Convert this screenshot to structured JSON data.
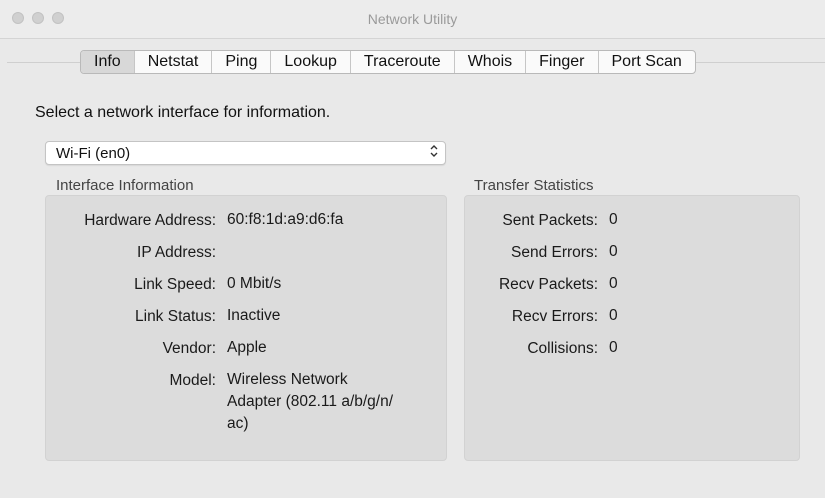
{
  "window": {
    "title": "Network Utility"
  },
  "tabs": [
    "Info",
    "Netstat",
    "Ping",
    "Lookup",
    "Traceroute",
    "Whois",
    "Finger",
    "Port Scan"
  ],
  "selected_tab": "Info",
  "prompt": "Select a network interface for information.",
  "interface_select": {
    "value": "Wi-Fi (en0)",
    "arrows": "⌃⌄"
  },
  "interface_info": {
    "title": "Interface Information",
    "hardware_address": {
      "label": "Hardware Address:",
      "value": "60:f8:1d:a9:d6:fa"
    },
    "ip_address": {
      "label": "IP Address:",
      "value": ""
    },
    "link_speed": {
      "label": "Link Speed:",
      "value": "0 Mbit/s"
    },
    "link_status": {
      "label": "Link Status:",
      "value": "Inactive"
    },
    "vendor": {
      "label": "Vendor:",
      "value": "Apple"
    },
    "model": {
      "label": "Model:",
      "value_line1": "Wireless Network",
      "value_line2": "Adapter (802.11 a/b/g/n/",
      "value_line3": "ac)"
    }
  },
  "transfer_stats": {
    "title": "Transfer Statistics",
    "sent_packets": {
      "label": "Sent Packets:",
      "value": "0"
    },
    "send_errors": {
      "label": "Send Errors:",
      "value": "0"
    },
    "recv_packets": {
      "label": "Recv Packets:",
      "value": "0"
    },
    "recv_errors": {
      "label": "Recv Errors:",
      "value": "0"
    },
    "collisions": {
      "label": "Collisions:",
      "value": "0"
    }
  }
}
